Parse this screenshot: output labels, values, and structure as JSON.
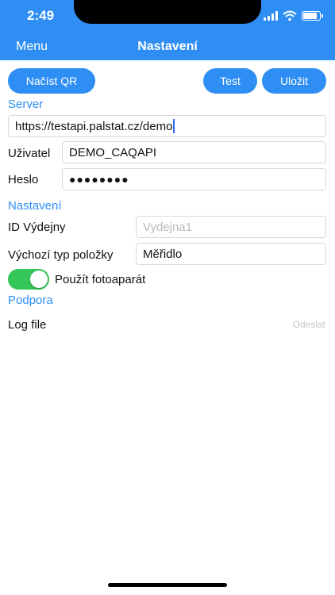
{
  "status": {
    "time": "2:49"
  },
  "nav": {
    "menu_label": "Menu",
    "title": "Nastavení"
  },
  "toolbar": {
    "load_qr_label": "Načíst QR",
    "test_label": "Test",
    "save_label": "Uložit"
  },
  "server": {
    "section_title": "Server",
    "url_value": "https://testapi.palstat.cz/demo",
    "user_label": "Uživatel",
    "user_value": "DEMO_CAQAPI",
    "password_label": "Heslo",
    "password_masked": "●●●●●●●●"
  },
  "settings": {
    "section_title": "Nastavení",
    "dispensary_id_label": "ID Výdejny",
    "dispensary_id_placeholder": "Vydejna1",
    "default_type_label": "Výchozí typ položky",
    "default_type_value": "Měřidlo",
    "use_camera_label": "Použít fotoaparát",
    "use_camera_enabled": true
  },
  "support": {
    "section_title": "Podpora",
    "log_file_label": "Log file",
    "send_label": "Odeslat"
  },
  "colors": {
    "accent": "#2f8ef4",
    "toggle_on": "#34c759"
  },
  "icons": [
    "signal-icon",
    "wifi-icon",
    "battery-icon"
  ]
}
